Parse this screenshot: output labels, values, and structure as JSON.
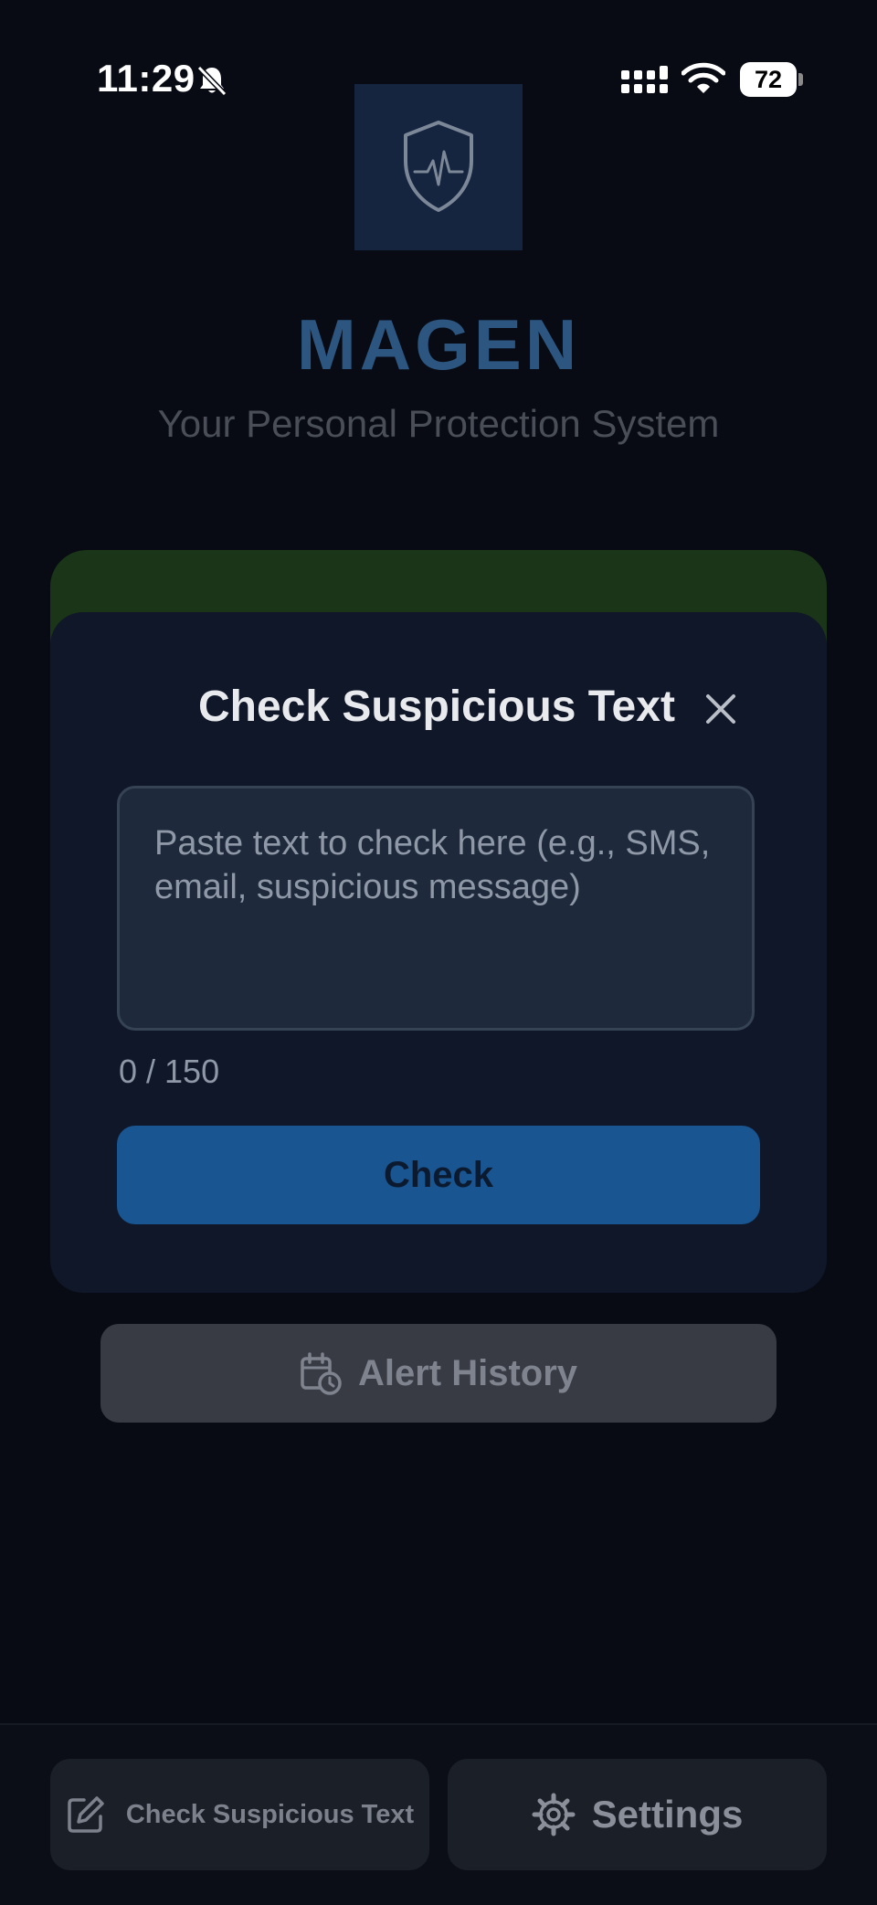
{
  "status_bar": {
    "time": "11:29",
    "battery": "72",
    "icons": [
      "bell-slash-icon",
      "signal-icon",
      "wifi-icon",
      "battery-icon"
    ]
  },
  "header": {
    "logo_icon": "shield-heartbeat-icon",
    "title": "MAGEN",
    "subtitle": "Your Personal Protection System"
  },
  "modal": {
    "title": "Check Suspicious Text",
    "close_icon": "close-icon",
    "input": {
      "value": "",
      "placeholder": "Paste text to check here (e.g., SMS, email, suspicious message)"
    },
    "char_count": "0 / 150",
    "check_label": "Check"
  },
  "alert_history": {
    "label": "Alert History",
    "icon": "calendar-clock-icon"
  },
  "bottom_nav": {
    "check_text_label": "Check Suspicious Text",
    "check_text_icon": "edit-icon",
    "settings_label": "Settings",
    "settings_icon": "gear-icon"
  },
  "colors": {
    "background": "#080b14",
    "accent_blue": "#195591",
    "title_blue": "#2c5680",
    "modal_bg": "#0f1729",
    "green_card": "#1b3518"
  }
}
